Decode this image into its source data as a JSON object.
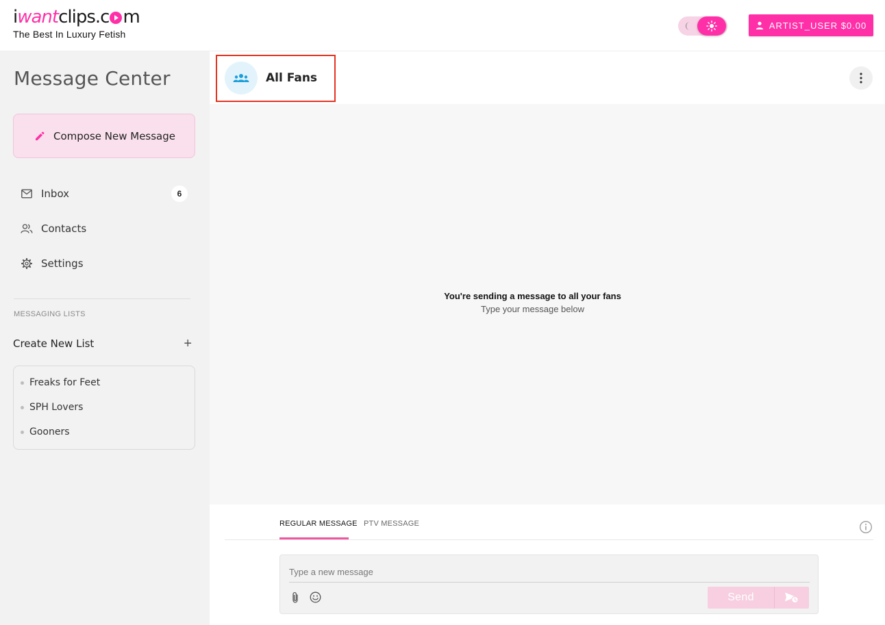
{
  "brand": {
    "logo_pre": "i",
    "logo_pink": "want",
    "logo_mid": "clips.c",
    "logo_post": "m",
    "tagline": "The Best In Luxury Fetish",
    "accent_color": "#ff2fa8"
  },
  "header": {
    "theme_toggle": {
      "mode": "light",
      "icons": [
        "moon-icon",
        "sun-icon"
      ]
    },
    "user_button_label": "ARTIST_USER $0.00"
  },
  "sidebar": {
    "title": "Message Center",
    "compose_label": "Compose New Message",
    "nav": [
      {
        "label": "Inbox",
        "icon": "mail-icon",
        "badge": "6"
      },
      {
        "label": "Contacts",
        "icon": "contacts-icon"
      },
      {
        "label": "Settings",
        "icon": "gear-icon"
      }
    ],
    "messaging_lists_label": "MESSAGING LISTS",
    "create_list_label": "Create New List",
    "create_list_icon": "+",
    "lists": [
      {
        "label": "Freaks for Feet"
      },
      {
        "label": "SPH Lovers"
      },
      {
        "label": "Gooners"
      }
    ]
  },
  "conversation": {
    "title": "All Fans",
    "icon": "group-icon",
    "empty_title": "You're sending a message to all your fans",
    "empty_subtitle": "Type your message below"
  },
  "composer": {
    "tabs": [
      {
        "label": "REGULAR MESSAGE",
        "active": true
      },
      {
        "label": "PTV MESSAGE",
        "active": false
      }
    ],
    "placeholder": "Type a new message",
    "value": "",
    "send_label": "Send"
  }
}
